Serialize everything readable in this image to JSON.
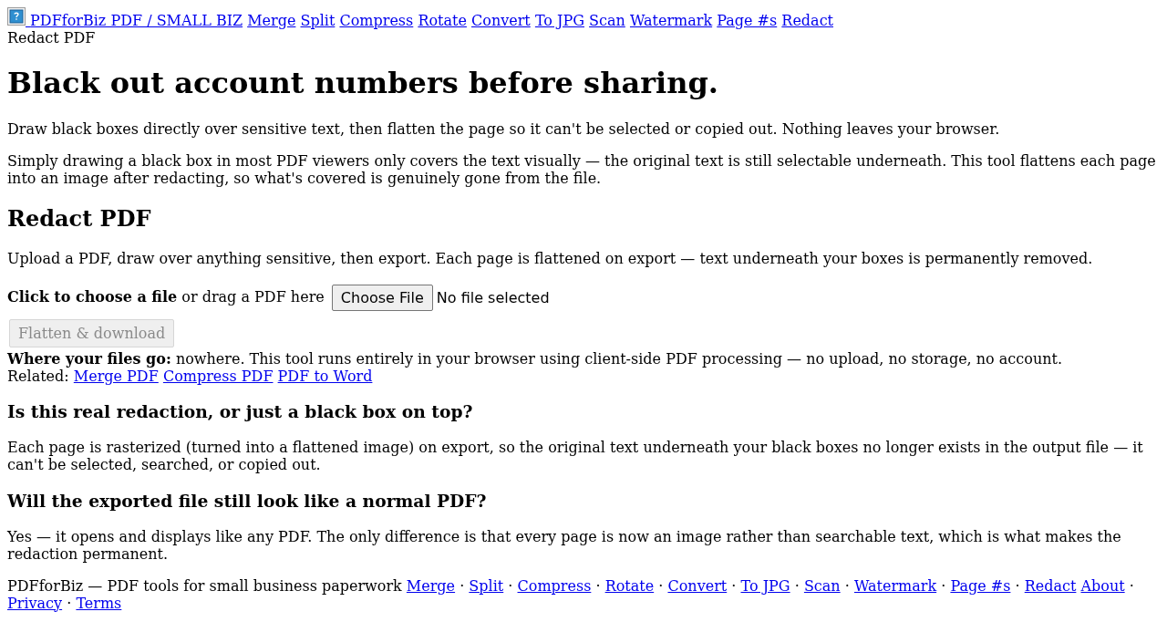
{
  "header": {
    "logo_link": "PDFforBiz PDF / SMALL BIZ",
    "nav": [
      "Merge",
      "Split",
      "Compress",
      "Rotate",
      "Convert",
      "To JPG",
      "Scan",
      "Watermark",
      "Page #s",
      "Redact"
    ],
    "breadcrumb": "Redact PDF"
  },
  "intro": {
    "title": "Black out account numbers before sharing.",
    "lead": "Draw black boxes directly over sensitive text, then flatten the page so it can't be selected or copied out. Nothing leaves your browser.",
    "note": "Simply drawing a black box in most PDF viewers only covers the text visually — the original text is still selectable underneath. This tool flattens each page into an image after redacting, so what's covered is genuinely gone from the file."
  },
  "tool": {
    "heading": "Redact PDF",
    "description": "Upload a PDF, draw over anything sensitive, then export. Each page is flattened on export — text underneath your boxes is permanently removed.",
    "upload": {
      "label": "**Click to choose a file** or drag a PDF here",
      "choose_button": "Choose File",
      "file_status": "No file selected"
    },
    "flatten_button": {
      "label": "Flatten & download",
      "disabled": true
    },
    "privacy": "**Where your files go:** nowhere. This tool runs entirely in your browser using client-side PDF processing — no upload, no storage, no account.",
    "related": {
      "label": "Related:",
      "links": [
        "Merge PDF",
        "Compress PDF",
        "PDF to Word"
      ]
    }
  },
  "faq": [
    {
      "question": "Is this real redaction, or just a black box on top?",
      "answer": "Each page is rasterized (turned into a flattened image) on export, so the original text underneath your black boxes no longer exists in the output file — it can't be selected, searched, or copied out."
    },
    {
      "question": "Will the exported file still look like a normal PDF?",
      "answer": "Yes — it opens and displays like any PDF. The only difference is that every page is now an image rather than searchable text, which is what makes the redaction permanent."
    }
  ],
  "footer": {
    "tagline": "PDFforBiz — PDF tools for small business paperwork",
    "links": [
      {
        "label": "Merge",
        "separator": "·"
      },
      {
        "label": "Split",
        "separator": "·"
      },
      {
        "label": "Compress",
        "separator": "·"
      },
      {
        "label": "Rotate",
        "separator": "·"
      },
      {
        "label": "Convert",
        "separator": "·"
      },
      {
        "label": "To JPG",
        "separator": "·"
      },
      {
        "label": "Scan",
        "separator": "·"
      },
      {
        "label": "Watermark",
        "separator": "·"
      },
      {
        "label": "Page #s",
        "separator": "·"
      },
      {
        "label": "Redact"
      },
      {
        "label": "About",
        "separator": "·"
      },
      {
        "label": "Privacy",
        "separator": "·"
      },
      {
        "label": "Terms"
      }
    ]
  }
}
